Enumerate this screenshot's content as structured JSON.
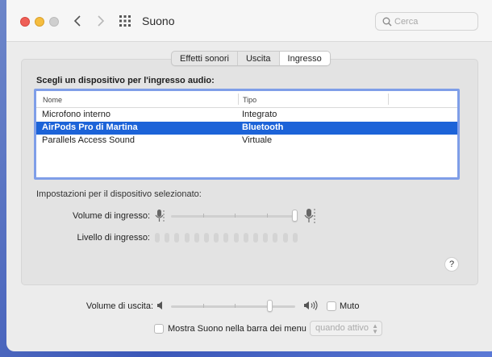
{
  "window": {
    "title": "Suono"
  },
  "search": {
    "placeholder": "Cerca"
  },
  "tabs": [
    {
      "label": "Effetti sonori"
    },
    {
      "label": "Uscita"
    },
    {
      "label": "Ingresso",
      "active": true
    }
  ],
  "input": {
    "section_label": "Scegli un dispositivo per l'ingresso audio:",
    "columns": [
      "Nome",
      "Tipo"
    ],
    "devices": [
      {
        "name": "Microfono interno",
        "type": "Integrato",
        "selected": false
      },
      {
        "name": "AirPods Pro di Martina",
        "type": "Bluetooth",
        "selected": true
      },
      {
        "name": "Parallels Access Sound",
        "type": "Virtuale",
        "selected": false
      }
    ],
    "settings_label": "Impostazioni per il dispositivo selezionato:",
    "volume_label": "Volume di ingresso:",
    "volume_value": 1.0,
    "level_label": "Livello di ingresso:",
    "level_segments": 15,
    "level_active": 0
  },
  "output": {
    "volume_label": "Volume di uscita:",
    "volume_value": 0.8,
    "mute_label": "Muto",
    "mute_checked": false
  },
  "menubar": {
    "show_label": "Mostra Suono nella barra dei menu",
    "show_checked": false,
    "when_value": "quando attivo"
  },
  "help": {
    "label": "?"
  },
  "colors": {
    "selection": "#1c63d8",
    "table_focus": "#7f9ee8"
  }
}
